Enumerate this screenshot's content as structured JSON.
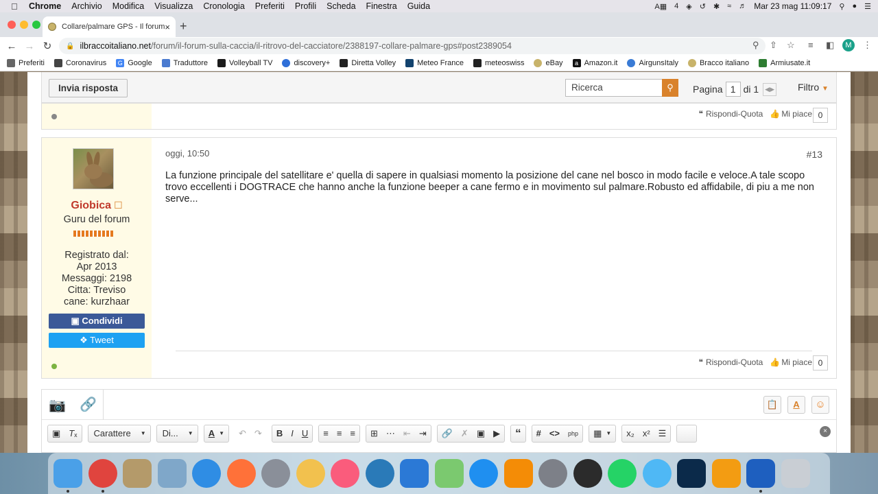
{
  "menubar": {
    "app": "Chrome",
    "items": [
      "Archivio",
      "Modifica",
      "Visualizza",
      "Cronologia",
      "Preferiti",
      "Profili",
      "Scheda",
      "Finestra",
      "Guida"
    ],
    "status_badge": "4",
    "clock": "Mar 23 mag  11:09:17"
  },
  "browser": {
    "tab_title": "Collare/palmare GPS - Il forum",
    "url_host": "ilbraccoitaliano.net",
    "url_path": "/forum/il-forum-sulla-caccia/il-ritrovo-del-cacciatore/2388197-collare-palmare-gps#post2389054",
    "profile_initial": "M"
  },
  "bookmarks": [
    {
      "label": "Preferiti",
      "icon": "folder-icon",
      "color": "#555555"
    },
    {
      "label": "Coronavirus",
      "icon": "news-icon",
      "color": "#444444"
    },
    {
      "label": "Google",
      "icon": "google-icon",
      "color": "#4285f4"
    },
    {
      "label": "Traduttore",
      "icon": "translate-icon",
      "color": "#4a7bd0"
    },
    {
      "label": "Volleyball TV",
      "icon": "volleyball-icon",
      "color": "#1b1b1b"
    },
    {
      "label": "discovery+",
      "icon": "discovery-icon",
      "color": "#2f6fd8"
    },
    {
      "label": "Diretta Volley",
      "icon": "volley-icon",
      "color": "#222222"
    },
    {
      "label": "Meteo France",
      "icon": "meteo-icon",
      "color": "#13436e"
    },
    {
      "label": "meteoswiss",
      "icon": "swiss-icon",
      "color": "#222222"
    },
    {
      "label": "eBay",
      "icon": "ebay-icon",
      "color": "#c8b36a"
    },
    {
      "label": "Amazon.it",
      "icon": "amazon-icon",
      "color": "#111111"
    },
    {
      "label": "AirgunsItaly",
      "icon": "airguns-icon",
      "color": "#3a7bd5"
    },
    {
      "label": "Bracco italiano",
      "icon": "bracco-icon",
      "color": "#c8b36a"
    },
    {
      "label": "Armiusate.it",
      "icon": "gun-icon",
      "color": "#2e7d32"
    }
  ],
  "actionbar": {
    "reply_label": "Invia risposta",
    "search_placeholder": "Ricerca",
    "page_label": "Pagina",
    "page_current": "1",
    "page_total_label": "di 1",
    "filter_label": "Filtro"
  },
  "posts": [
    {
      "reply_quote_label": "Rispondi-Quota",
      "like_label": "Mi piace",
      "like_count": "0",
      "status_color": "#888888"
    },
    {
      "date": "oggi, 10:50",
      "number": "#13",
      "author": "Giobica",
      "rank": "Guru del forum",
      "info_lines": [
        "Registrato dal:",
        "Apr 2013",
        "Messaggi: 2198",
        "Citta: Treviso",
        "cane: kurzhaar"
      ],
      "text": "La funzione principale del satellitare e' quella di sapere in qualsiasi momento la posizione del cane nel bosco in modo facile e veloce.A tale scopo trovo eccellenti i DOGTRACE che hanno anche la funzione beeper a cane fermo e in movimento sul palmare.Robusto ed affidabile, di piu a me non serve...",
      "share_facebook": "Condividi",
      "share_twitter": "Tweet",
      "reply_quote_label": "Rispondi-Quota",
      "like_label": "Mi piace",
      "like_count": "0",
      "status_color": "#7cb342"
    }
  ],
  "editor": {
    "font_select": "Carattere",
    "size_select": "Di...",
    "font_color": "A"
  },
  "colors": {
    "accent": "#d9822b",
    "username": "#c0392b",
    "facebook": "#3b5998",
    "twitter": "#1da1f2"
  },
  "dock": [
    {
      "name": "finder-icon",
      "color": "#4aa0e8"
    },
    {
      "name": "chrome-icon",
      "color": "#e0443e"
    },
    {
      "name": "preview-stamp-icon",
      "color": "#b49a6a"
    },
    {
      "name": "preview-icon",
      "color": "#7fa7c9"
    },
    {
      "name": "safari-icon",
      "color": "#2f8de4"
    },
    {
      "name": "firefox-icon",
      "color": "#ff7139"
    },
    {
      "name": "launchpad-icon",
      "color": "#8a8f99"
    },
    {
      "name": "photos-icon",
      "color": "#f2c14e"
    },
    {
      "name": "music-icon",
      "color": "#fa5c7c"
    },
    {
      "name": "quicktime-icon",
      "color": "#2a7ab8"
    },
    {
      "name": "word-icon",
      "color": "#2b79d6"
    },
    {
      "name": "maps-icon",
      "color": "#7bc96f"
    },
    {
      "name": "app-store-icon",
      "color": "#1f8ff0"
    },
    {
      "name": "vlc-icon",
      "color": "#f48c06"
    },
    {
      "name": "system-preferences-icon",
      "color": "#7d8088"
    },
    {
      "name": "photo-booth-icon",
      "color": "#2b2b2b"
    },
    {
      "name": "whatsapp-icon",
      "color": "#25d366"
    },
    {
      "name": "messages-icon",
      "color": "#4fb8f5"
    },
    {
      "name": "photoshop-icon",
      "color": "#0b2a4a"
    },
    {
      "name": "calculator-icon",
      "color": "#f39c12"
    },
    {
      "name": "preview-edit-icon",
      "color": "#1e5fbf"
    },
    {
      "name": "trash-icon",
      "color": "#c9ced4"
    }
  ]
}
